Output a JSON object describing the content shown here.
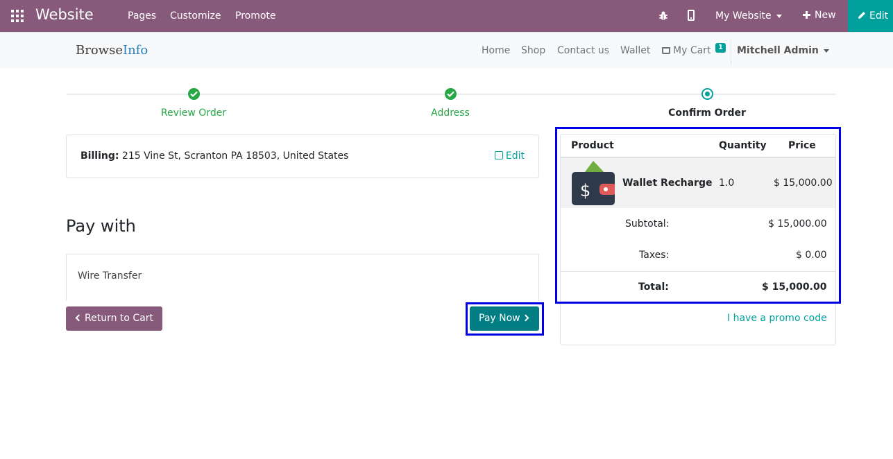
{
  "topbar": {
    "app_title": "Website",
    "menu": [
      "Pages",
      "Customize",
      "Promote"
    ],
    "website_switcher": "My Website",
    "new_label": "New",
    "edit_label": "Edit"
  },
  "site": {
    "logo": {
      "part1": "Browse",
      "part2": "Info"
    },
    "nav": [
      "Home",
      "Shop",
      "Contact us",
      "Wallet"
    ],
    "cart_label": "My Cart",
    "cart_count": "1",
    "user": "Mitchell Admin"
  },
  "wizard": {
    "steps": [
      {
        "label": "Review Order",
        "state": "done"
      },
      {
        "label": "Address",
        "state": "done"
      },
      {
        "label": "Confirm Order",
        "state": "current"
      }
    ]
  },
  "billing": {
    "label": "Billing:",
    "address": "215 Vine St, Scranton PA 18503, United States",
    "edit_label": "Edit"
  },
  "payment": {
    "heading": "Pay with",
    "method": "Wire Transfer",
    "return_label": "Return to Cart",
    "paynow_label": "Pay Now"
  },
  "summary": {
    "headers": {
      "product": "Product",
      "quantity": "Quantity",
      "price": "Price"
    },
    "line": {
      "name": "Wallet Recharge",
      "qty": "1.0",
      "price": "$ 15,000.00"
    },
    "subtotal_label": "Subtotal:",
    "subtotal": "$ 15,000.00",
    "taxes_label": "Taxes:",
    "taxes": "$ 0.00",
    "total_label": "Total:",
    "total": "$ 15,000.00",
    "promo_label": "I have a promo code"
  },
  "colors": {
    "primary": "#875a7b",
    "accent": "#00a09d",
    "success": "#28a745",
    "paynow": "#017e84",
    "highlight": "#0000e6"
  }
}
